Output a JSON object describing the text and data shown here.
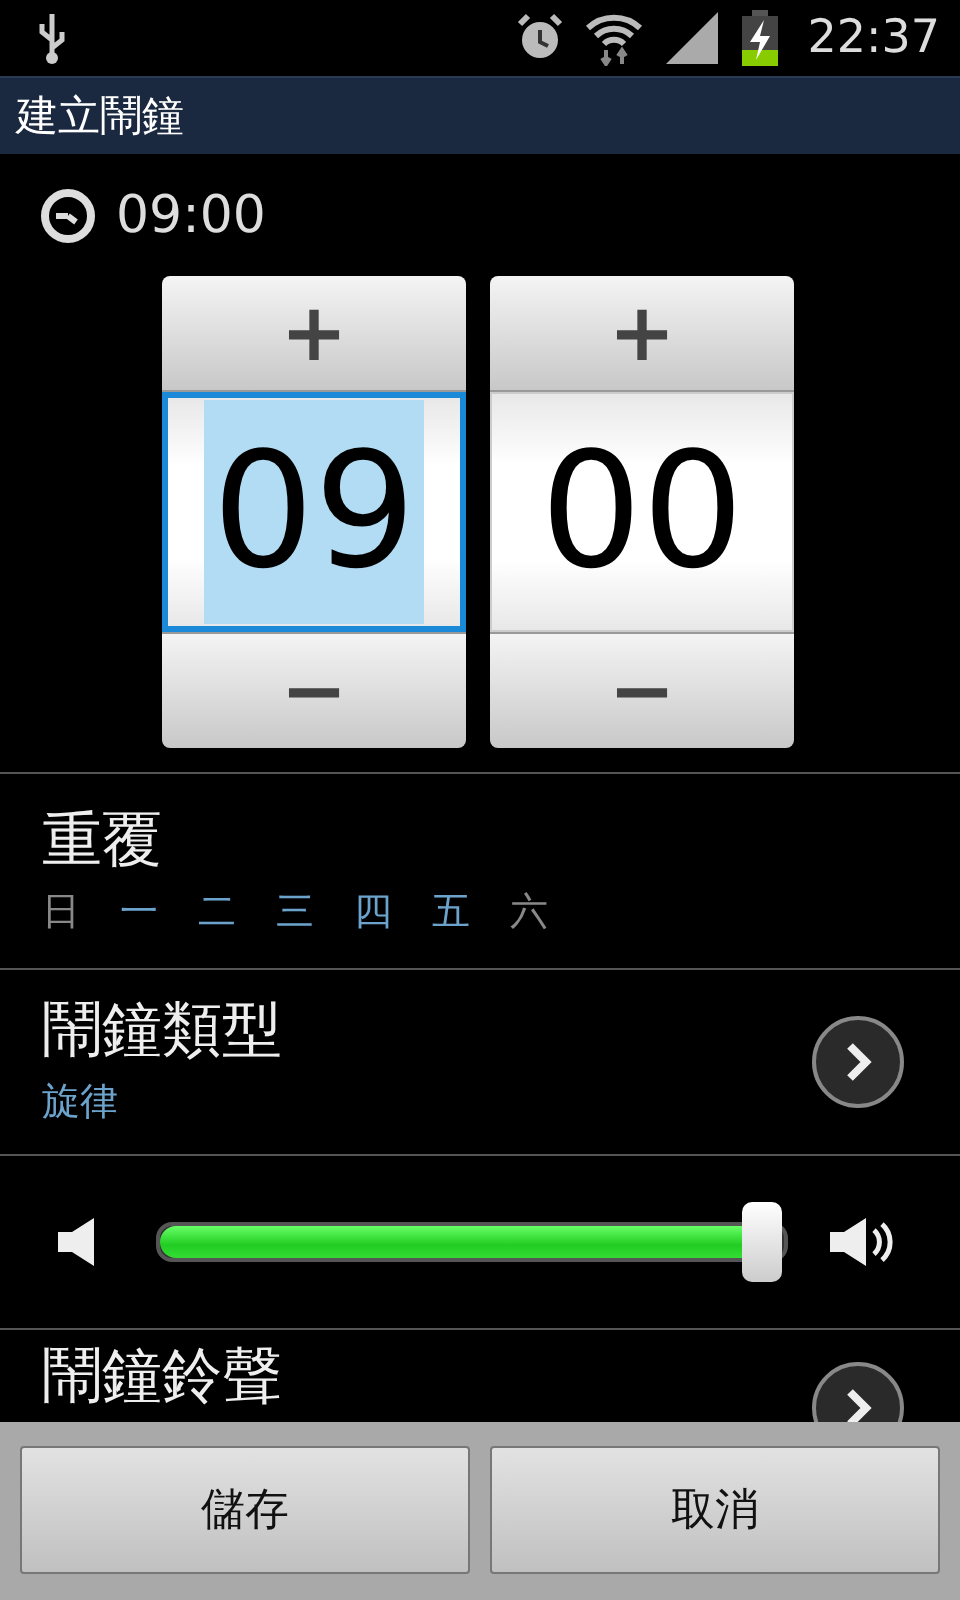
{
  "status_bar": {
    "time": "22:37"
  },
  "title_bar": {
    "title": "建立鬧鐘"
  },
  "time_display": {
    "time": "09:00"
  },
  "time_picker": {
    "columns": [
      {
        "increment": "+",
        "value": "09",
        "decrement": "−",
        "selected": true
      },
      {
        "increment": "+",
        "value": "00",
        "decrement": "−",
        "selected": false
      }
    ]
  },
  "repeat": {
    "label": "重覆",
    "days": [
      {
        "label": "日",
        "selected": false
      },
      {
        "label": "一",
        "selected": true
      },
      {
        "label": "二",
        "selected": true
      },
      {
        "label": "三",
        "selected": true
      },
      {
        "label": "四",
        "selected": true
      },
      {
        "label": "五",
        "selected": true
      },
      {
        "label": "六",
        "selected": false
      }
    ]
  },
  "alarm_type": {
    "label": "鬧鐘類型",
    "value": "旋律"
  },
  "volume": {
    "level": 0.97
  },
  "ringtone": {
    "label": "鬧鐘鈴聲"
  },
  "buttons": [
    "儲存",
    "取消"
  ]
}
